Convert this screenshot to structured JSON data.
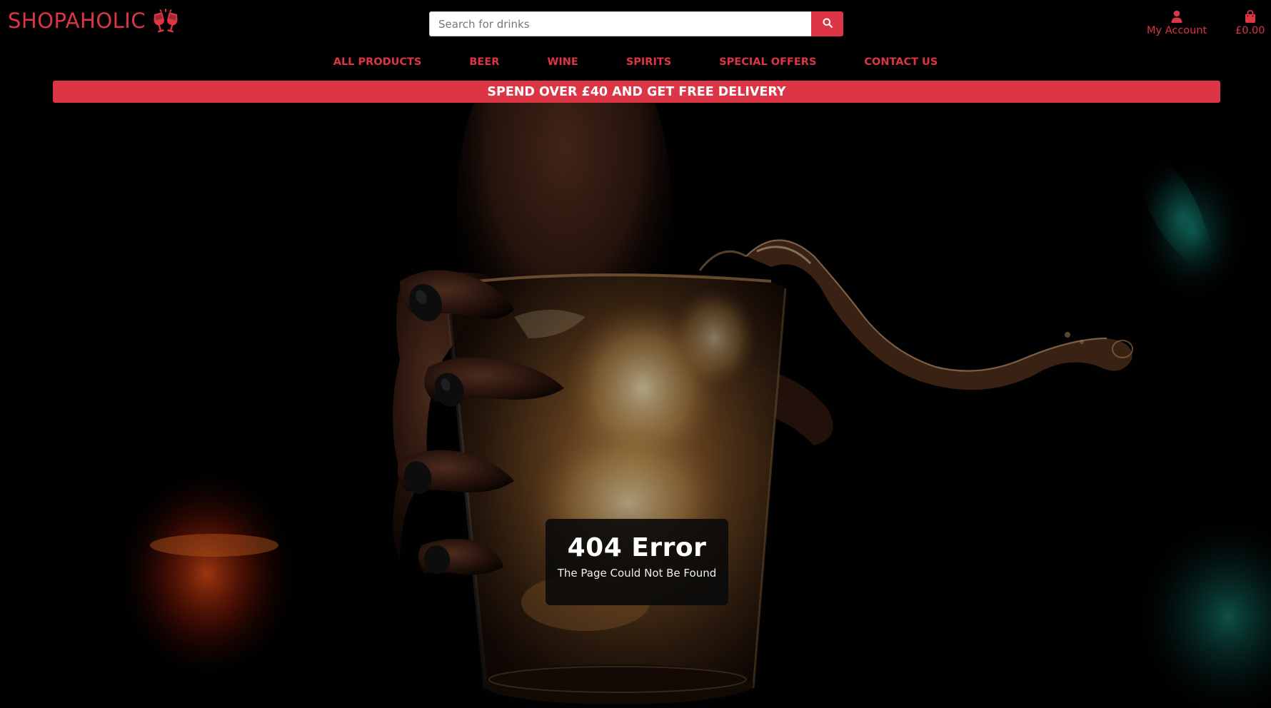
{
  "brand": {
    "name": "SHOPAHOLIC",
    "icon": "glass-cheers-icon",
    "color": "#dc3545"
  },
  "search": {
    "placeholder": "Search for drinks",
    "value": "",
    "icon": "search-icon"
  },
  "account": {
    "label": "My Account",
    "icon": "user-icon"
  },
  "bag": {
    "total": "£0.00",
    "icon": "shopping-bag-icon"
  },
  "nav": {
    "items": [
      {
        "label": "ALL PRODUCTS"
      },
      {
        "label": "BEER"
      },
      {
        "label": "WINE"
      },
      {
        "label": "SPIRITS"
      },
      {
        "label": "SPECIAL OFFERS"
      },
      {
        "label": "CONTACT US"
      }
    ]
  },
  "banner": {
    "text": "SPEND OVER £40 AND GET FREE DELIVERY"
  },
  "error": {
    "title": "404 Error",
    "message": "The Page Could Not Be Found"
  }
}
